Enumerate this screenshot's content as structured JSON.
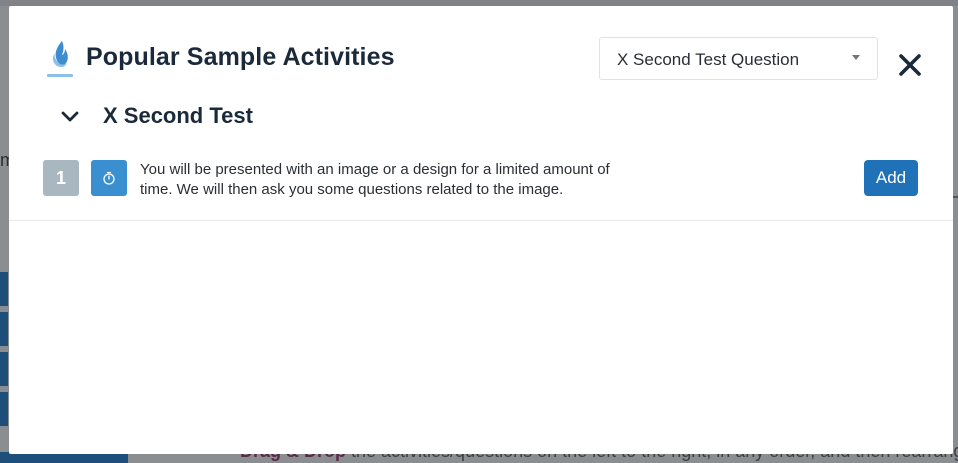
{
  "background": {
    "left_fragment": "m",
    "bottom_text_bold": "Drag & Drop",
    "bottom_text_rest": " the activities/questions on the left to the right, in any order, and then rearrange"
  },
  "modal": {
    "title": "Popular Sample Activities",
    "logo_icon": "flame-logo-icon",
    "select": {
      "value": "X Second Test Question"
    },
    "close_icon": "close-icon",
    "section": {
      "title": "X Second Test",
      "chevron_icon": "chevron-down-icon"
    },
    "activities": [
      {
        "number": "1",
        "icon": "stopwatch-icon",
        "description": "You will be presented with an image or a design for a limited amount of time. We will then ask you some questions related to the image.",
        "add_label": "Add"
      }
    ]
  },
  "colors": {
    "accent": "#1f72b8",
    "timer_badge": "#3a8fd0",
    "number_badge": "#a9b7c1",
    "title_text": "#1b2a3a",
    "overlay": "#8b8e91"
  }
}
